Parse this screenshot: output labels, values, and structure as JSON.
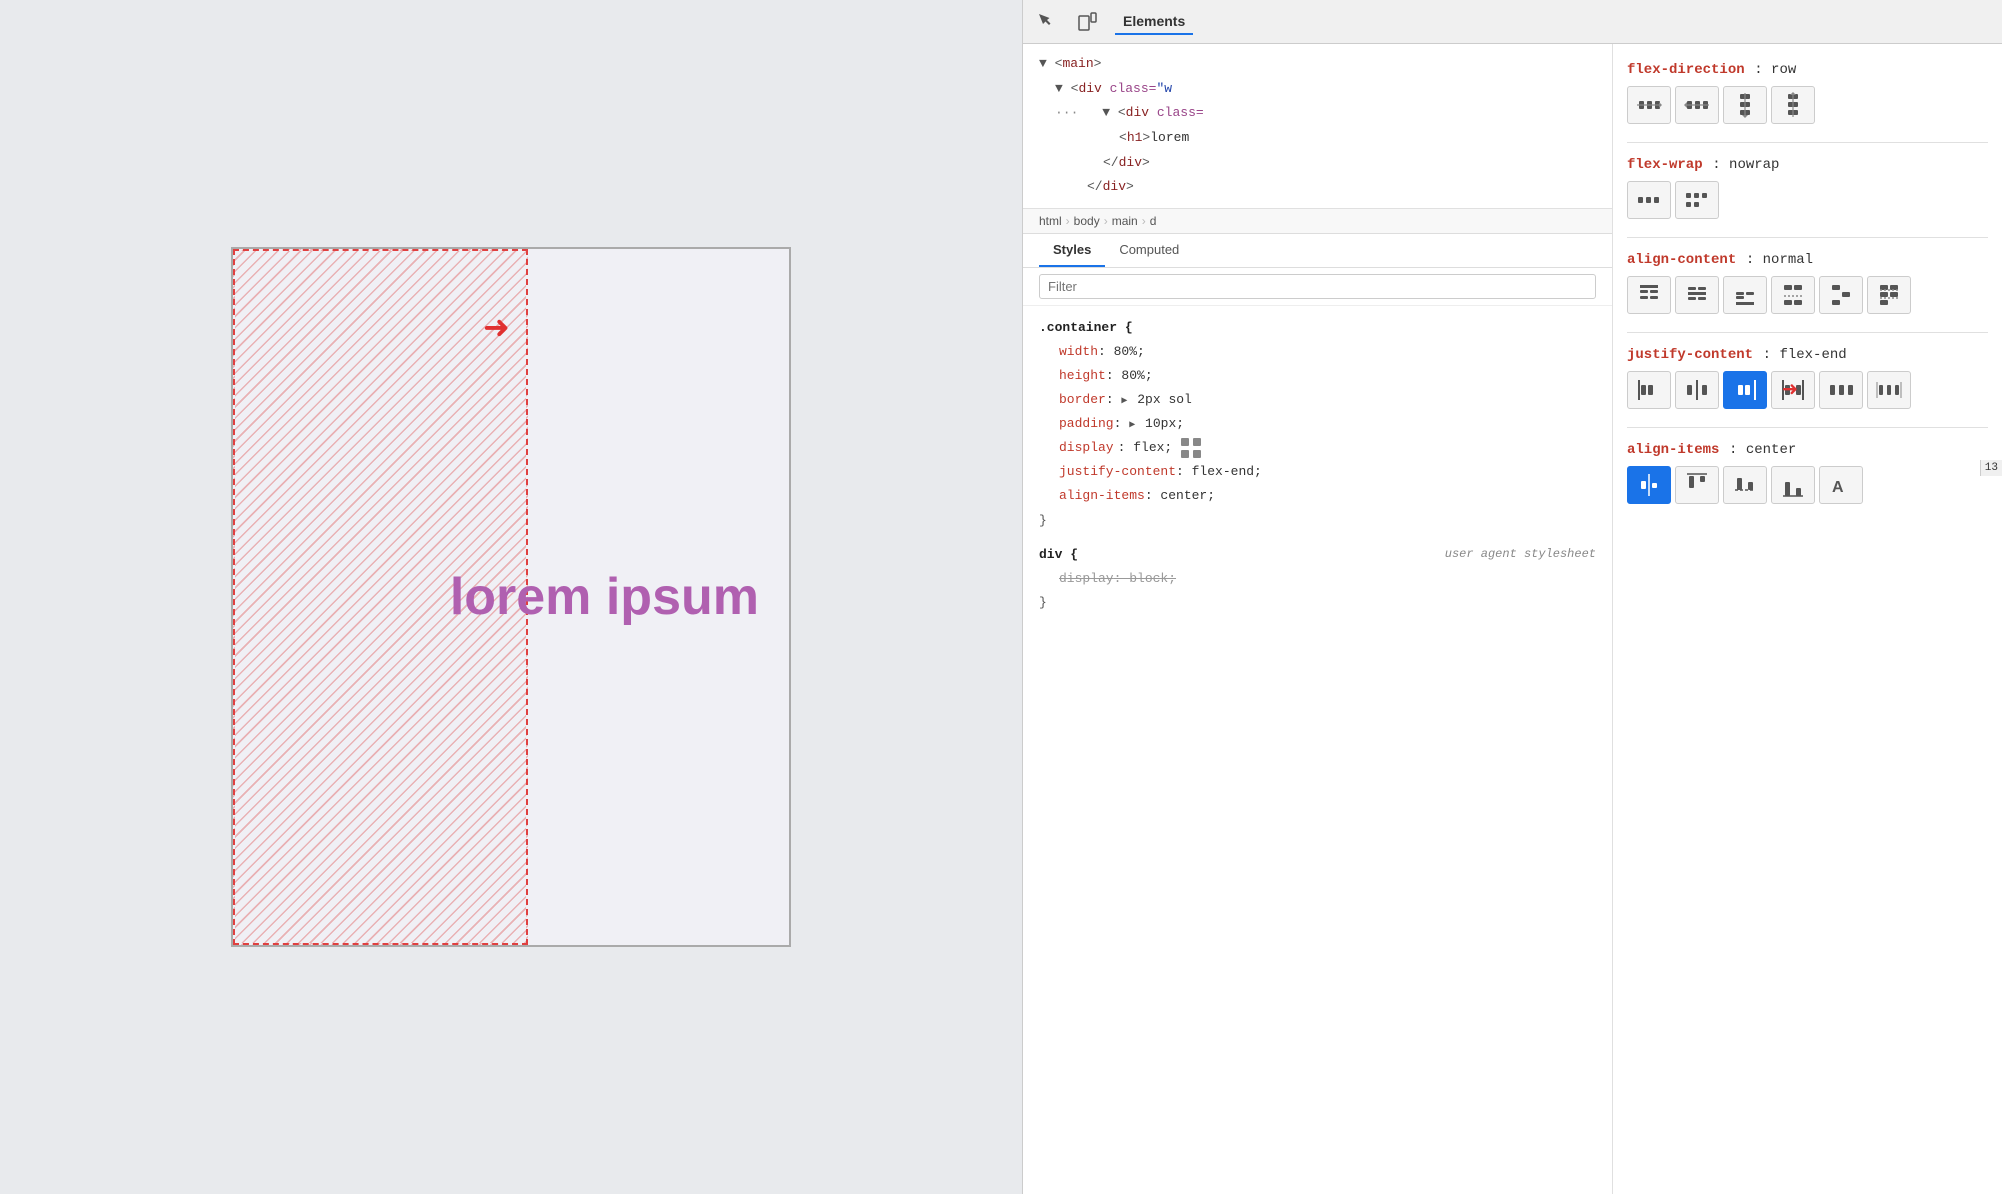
{
  "preview": {
    "text": "lorem ipsum"
  },
  "devtools": {
    "header": {
      "tab": "Elements"
    },
    "tree": {
      "line1": "<main>",
      "line2": "<div class=\"w",
      "line3": "<div class=",
      "line4": "<h1>lorem",
      "line5": "</div>",
      "line6": "</div>"
    },
    "breadcrumb": [
      "html",
      "body",
      "main",
      "d"
    ],
    "tabs": [
      "Styles",
      "Computed"
    ],
    "filter_placeholder": "Filter",
    "css_rules": [
      {
        "selector": ".container {",
        "properties": [
          {
            "prop": "width",
            "value": "80%;",
            "strikethrough": false
          },
          {
            "prop": "height",
            "value": "80%;",
            "strikethrough": false
          },
          {
            "prop": "border",
            "value": "▶ 2px sol",
            "strikethrough": false
          },
          {
            "prop": "padding",
            "value": "▶ 10px;",
            "strikethrough": false
          },
          {
            "prop": "display",
            "value": "flex;",
            "strikethrough": false
          },
          {
            "prop": "justify-content",
            "value": "flex-end;",
            "strikethrough": false
          },
          {
            "prop": "align-items",
            "value": "center;",
            "strikethrough": false
          }
        ]
      },
      {
        "selector": "div {",
        "user_agent": "user agent stylesheet",
        "properties": [
          {
            "prop": "display",
            "value": "block;",
            "strikethrough": true
          }
        ]
      }
    ]
  },
  "flex_panel": {
    "flex_direction": {
      "label": "flex-direction",
      "value": "row",
      "buttons": [
        {
          "id": "row",
          "icon": "row",
          "active": false
        },
        {
          "id": "row-rev",
          "icon": "row-reverse",
          "active": false
        },
        {
          "id": "col",
          "icon": "column",
          "active": false
        },
        {
          "id": "col-rev",
          "icon": "col-reverse",
          "active": false
        }
      ]
    },
    "flex_wrap": {
      "label": "flex-wrap",
      "value": "nowrap",
      "buttons": [
        {
          "id": "nowrap",
          "icon": "nowrap",
          "active": false
        },
        {
          "id": "wrap",
          "icon": "wrap",
          "active": false
        }
      ]
    },
    "align_content": {
      "label": "align-content",
      "value": "normal",
      "buttons": [
        {
          "id": "ac1",
          "active": false
        },
        {
          "id": "ac2",
          "active": false
        },
        {
          "id": "ac3",
          "active": false
        },
        {
          "id": "ac4",
          "active": false
        },
        {
          "id": "ac5",
          "active": false
        },
        {
          "id": "ac6",
          "active": false
        }
      ]
    },
    "justify_content": {
      "label": "justify-content",
      "value": "flex-end",
      "buttons": [
        {
          "id": "jc1",
          "active": false
        },
        {
          "id": "jc2",
          "active": false
        },
        {
          "id": "jc3",
          "active": true
        },
        {
          "id": "jc4",
          "active": false
        },
        {
          "id": "jc5",
          "active": false
        },
        {
          "id": "jc6",
          "active": false
        }
      ]
    },
    "align_items": {
      "label": "align-items",
      "value": "center",
      "buttons": [
        {
          "id": "ai1",
          "active": true
        },
        {
          "id": "ai2",
          "active": false
        },
        {
          "id": "ai3",
          "active": false
        },
        {
          "id": "ai4",
          "active": false
        },
        {
          "id": "ai5",
          "active": false
        }
      ]
    }
  },
  "scrollbar_number": "13"
}
